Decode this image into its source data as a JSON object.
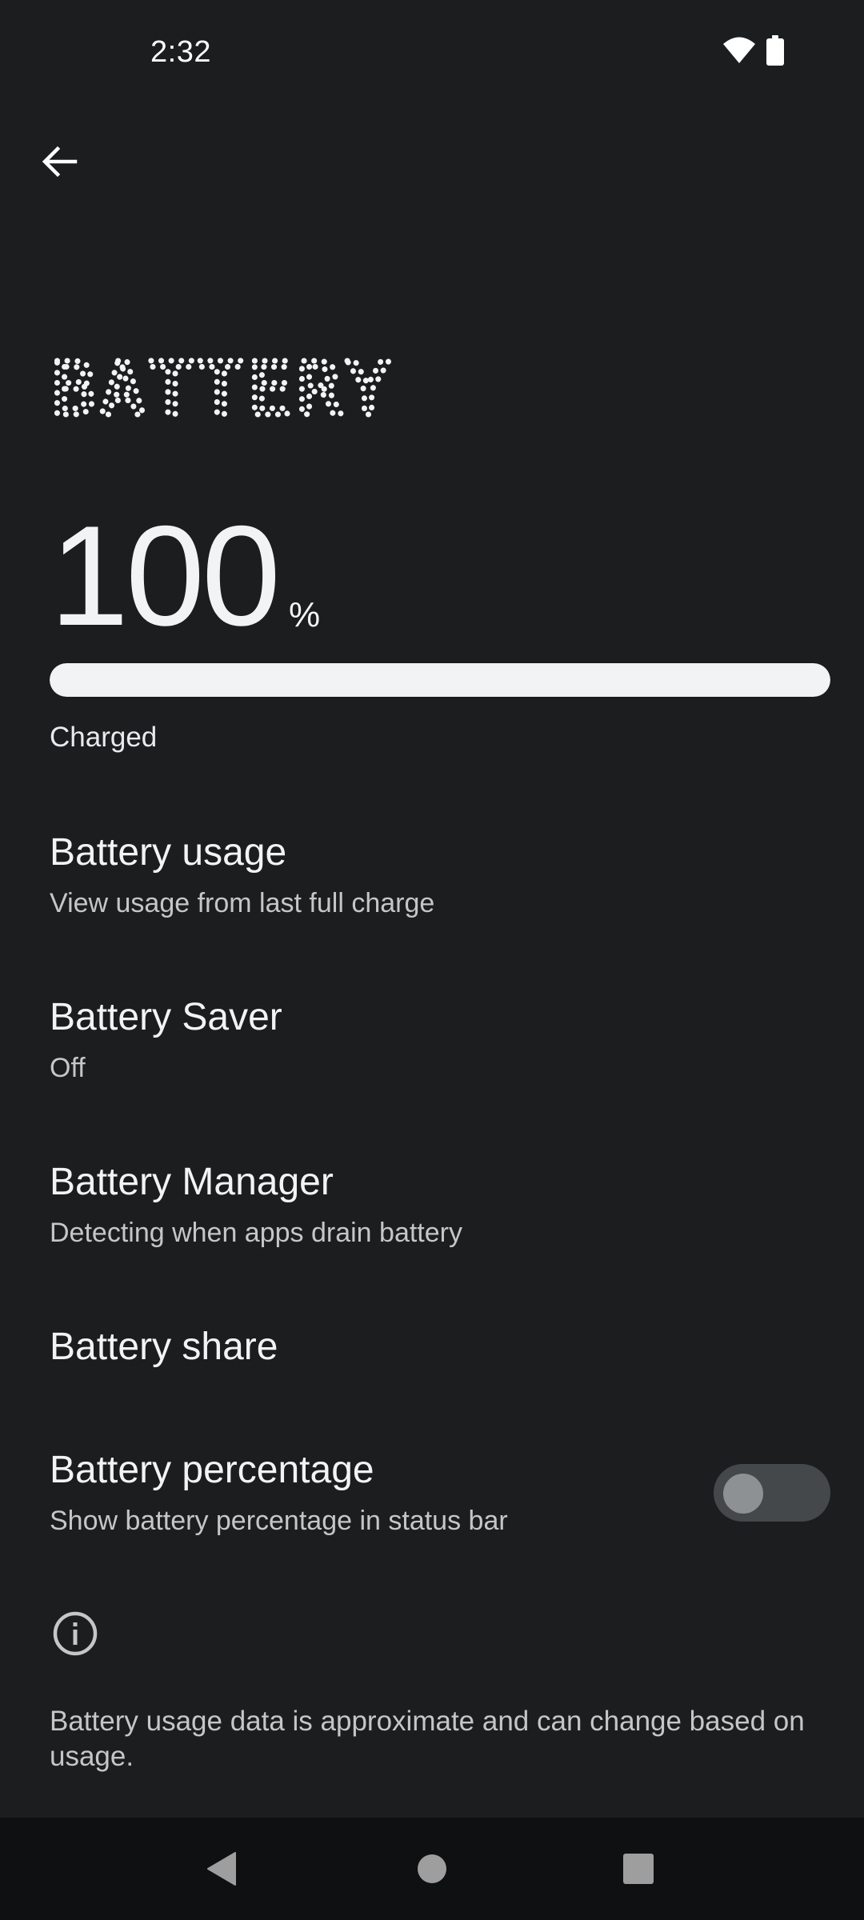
{
  "status_bar": {
    "time": "2:32"
  },
  "header": {
    "title": "BATTERY"
  },
  "battery": {
    "level_value": "100",
    "level_unit": "%",
    "level_fraction": 1.0,
    "status": "Charged"
  },
  "settings": [
    {
      "title": "Battery usage",
      "summary": "View usage from last full charge"
    },
    {
      "title": "Battery Saver",
      "summary": "Off"
    },
    {
      "title": "Battery Manager",
      "summary": "Detecting when apps drain battery"
    },
    {
      "title": "Battery share",
      "summary": ""
    },
    {
      "title": "Battery percentage",
      "summary": "Show battery percentage in status bar",
      "toggle_on": false
    }
  ],
  "footer": {
    "text": "Battery usage data is approximate and can change based on usage."
  },
  "colors": {
    "background": "#1b1d1f",
    "text_primary": "#f1f3f4",
    "text_secondary": "#c4c7c5",
    "nav_bar": "#0f1011"
  },
  "icons": {
    "back": "arrow-back-icon",
    "wifi": "wifi-icon",
    "battery": "battery-icon",
    "info": "info-icon",
    "nav_back": "nav-back-icon",
    "nav_home": "nav-home-icon",
    "nav_recents": "nav-recents-icon"
  }
}
